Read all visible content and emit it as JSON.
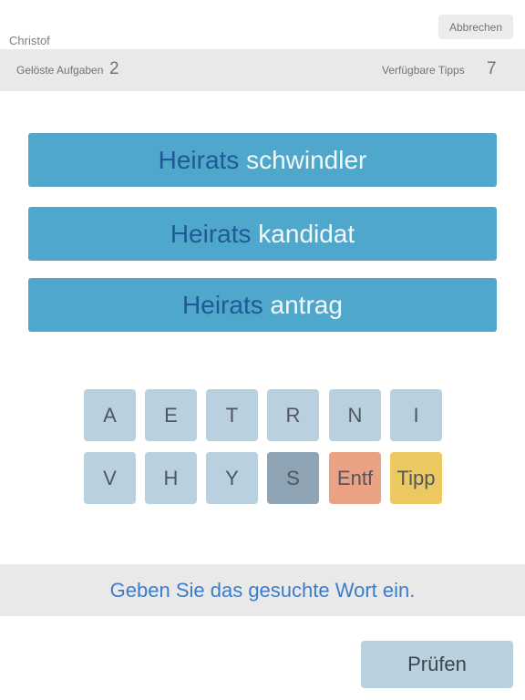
{
  "header": {
    "username": "Christof",
    "cancel_label": "Abbrechen",
    "solved_label": "Gelöste Aufgaben",
    "solved_value": "2",
    "hints_label": "Verfügbare Tipps",
    "hints_value": "7"
  },
  "words": [
    {
      "prefix": "Heirats",
      "suffix": "schwindler"
    },
    {
      "prefix": "Heirats",
      "suffix": "kandidat"
    },
    {
      "prefix": "Heirats",
      "suffix": "antrag"
    }
  ],
  "keyboard": {
    "row1": [
      "A",
      "E",
      "T",
      "R",
      "N",
      "I"
    ],
    "row2": [
      "V",
      "H",
      "Y",
      "S"
    ],
    "delete_label": "Entf",
    "hint_label": "Tipp",
    "selected_key": "S"
  },
  "instruction": "Geben Sie das gesuchte Wort ein.",
  "check_label": "Prüfen",
  "colors": {
    "word_background": "#4fa8cc",
    "word_prefix": "#1f5a96",
    "word_suffix": "#f3f8fb",
    "key_background": "#b9d0df",
    "key_selected": "#8ea4b5",
    "key_delete": "#eba184",
    "key_hint": "#ecc861",
    "instruction_text": "#3d7dc8"
  }
}
